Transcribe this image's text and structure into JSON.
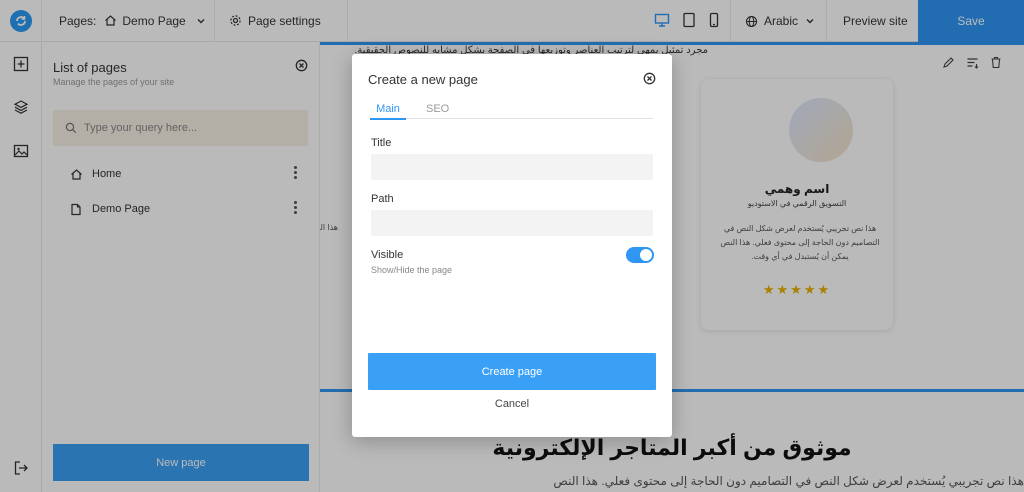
{
  "topbar": {
    "pages_label": "Pages:",
    "current_page": "Demo Page",
    "page_settings": "Page settings",
    "language": "Arabic",
    "preview": "Preview site",
    "save": "Save"
  },
  "panel": {
    "title": "List of pages",
    "subtitle": "Manage the pages of your site",
    "search_placeholder": "Type your query here...",
    "pages": [
      {
        "label": "Home",
        "icon": "home-icon"
      },
      {
        "label": "Demo Page",
        "icon": "file-icon"
      }
    ],
    "new_page_button": "New page"
  },
  "canvas": {
    "top_text": "مجرد تمثيل يمهي لترتيب العناصر وتوزيعها في الصفحة بشكل مشابه للنصوص الحقيقية.",
    "card_name": "اسم وهمي",
    "card_role": "التسويق الرقمي في الاستوديو",
    "card_text": "هذا نص تجريبي يُستخدم لعرض شكل النص في التصاميم دون الحاجة إلى محتوى فعلي. هذا النص يمكن أن يُستبدل في أي وقت.",
    "card_stars": "★★★★★",
    "side_text": "هذا النص",
    "heading": "موثوق من أكبر المتاجر الإلكترونية",
    "paragraph": "هذا نص تجريبي يُستخدم لعرض شكل النص في التصاميم دون الحاجة إلى محتوى فعلي. هذا النص"
  },
  "modal": {
    "title": "Create a new page",
    "tabs": [
      "Main",
      "SEO"
    ],
    "title_label": "Title",
    "title_value": "",
    "path_label": "Path",
    "path_value": "",
    "visible_label": "Visible",
    "visible_sub": "Show/Hide the page",
    "visible_on": true,
    "create_button": "Create page",
    "cancel": "Cancel"
  },
  "colors": {
    "accent": "#2f96f4",
    "button": "#3aa0f5",
    "search_bg": "#f6efe4",
    "star": "#e8b000"
  }
}
